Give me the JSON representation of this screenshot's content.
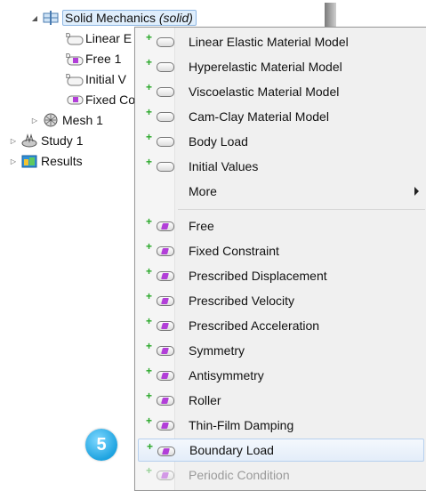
{
  "tree": {
    "physics": {
      "label": "Solid Mechanics",
      "tag": "(solid)"
    },
    "children": [
      {
        "label": "Linear E"
      },
      {
        "label": "Free 1"
      },
      {
        "label": "Initial V"
      },
      {
        "label": "Fixed Co"
      }
    ],
    "mesh": {
      "label": "Mesh 1"
    },
    "study": {
      "label": "Study 1"
    },
    "results": {
      "label": "Results"
    }
  },
  "menu": {
    "domain_items": [
      "Linear Elastic Material Model",
      "Hyperelastic Material Model",
      "Viscoelastic Material Model",
      "Cam-Clay Material Model",
      "Body Load",
      "Initial Values"
    ],
    "more_label": "More",
    "boundary_items": [
      "Free",
      "Fixed Constraint",
      "Prescribed Displacement",
      "Prescribed Velocity",
      "Prescribed Acceleration",
      "Symmetry",
      "Antisymmetry",
      "Roller",
      "Thin-Film Damping",
      "Boundary Load",
      "Periodic Condition"
    ],
    "highlighted": "Boundary Load"
  },
  "step_badge": "5"
}
